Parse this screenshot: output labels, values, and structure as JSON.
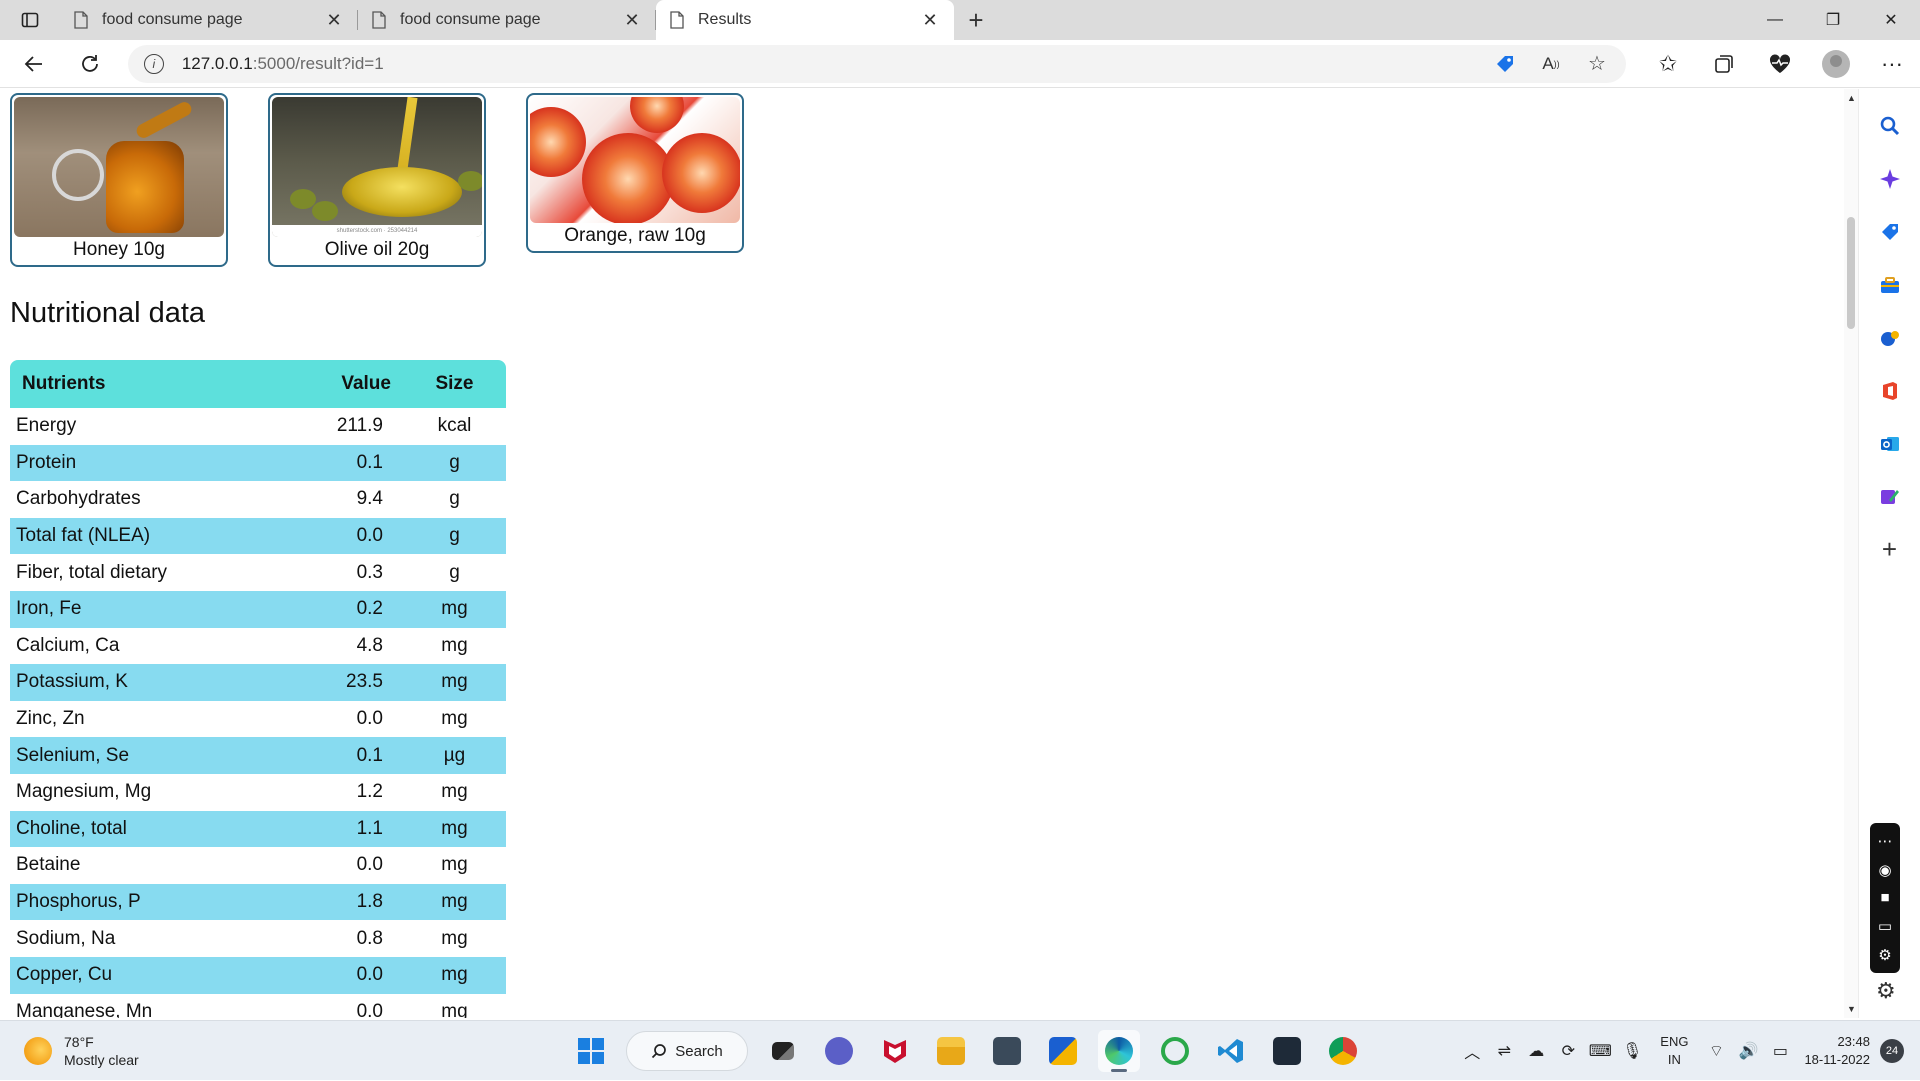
{
  "browser": {
    "tabs": [
      {
        "title": "food consume page",
        "active": false
      },
      {
        "title": "food consume page",
        "active": false
      },
      {
        "title": "Results",
        "active": true
      }
    ],
    "new_tab": "+",
    "url_host": "127.0.0.1",
    "url_rest": ":5000/result?id=1"
  },
  "foods": [
    {
      "caption": "Honey 10g",
      "image": "honey-jar"
    },
    {
      "caption": "Olive oil 20g",
      "image": "olive-oil-bowl",
      "image_caption": "shutterstock.com · 253044214"
    },
    {
      "caption": "Orange, raw 10g",
      "image": "blood-orange-slices"
    }
  ],
  "nutrition": {
    "title": "Nutritional data",
    "headers": {
      "nutrient": "Nutrients",
      "value": "Value",
      "size": "Size"
    },
    "rows": [
      {
        "name": "Energy",
        "value": "211.9",
        "unit": "kcal"
      },
      {
        "name": "Protein",
        "value": "0.1",
        "unit": "g"
      },
      {
        "name": "Carbohydrates",
        "value": "9.4",
        "unit": "g"
      },
      {
        "name": "Total fat (NLEA)",
        "value": "0.0",
        "unit": "g"
      },
      {
        "name": "Fiber, total dietary",
        "value": "0.3",
        "unit": "g"
      },
      {
        "name": "Iron, Fe",
        "value": "0.2",
        "unit": "mg"
      },
      {
        "name": "Calcium, Ca",
        "value": "4.8",
        "unit": "mg"
      },
      {
        "name": "Potassium, K",
        "value": "23.5",
        "unit": "mg"
      },
      {
        "name": "Zinc, Zn",
        "value": "0.0",
        "unit": "mg"
      },
      {
        "name": "Selenium, Se",
        "value": "0.1",
        "unit": "µg"
      },
      {
        "name": "Magnesium, Mg",
        "value": "1.2",
        "unit": "mg"
      },
      {
        "name": "Choline, total",
        "value": "1.1",
        "unit": "mg"
      },
      {
        "name": "Betaine",
        "value": "0.0",
        "unit": "mg"
      },
      {
        "name": "Phosphorus, P",
        "value": "1.8",
        "unit": "mg"
      },
      {
        "name": "Sodium, Na",
        "value": "0.8",
        "unit": "mg"
      },
      {
        "name": "Copper, Cu",
        "value": "0.0",
        "unit": "mg"
      },
      {
        "name": "Manganese, Mn",
        "value": "0.0",
        "unit": "mg"
      }
    ]
  },
  "taskbar": {
    "weather_temp": "78°F",
    "weather_desc": "Mostly clear",
    "search_label": "Search",
    "lang_top": "ENG",
    "lang_bottom": "IN",
    "time": "23:48",
    "date": "18-11-2022",
    "notification_count": "24"
  },
  "colors": {
    "table_header": "#5de0dc",
    "table_alt_row": "#87dbf0",
    "card_border": "#2e6a8a"
  }
}
